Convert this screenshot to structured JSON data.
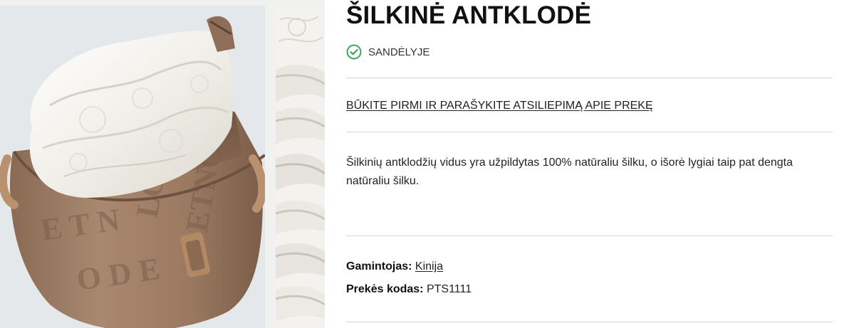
{
  "product": {
    "title": "ŠILKINĖ ANTKLODĖ",
    "stock_status": "SANDĖLYJE",
    "review_link": "BŪKITE PIRMI IR PARAŠYKITE ATSILIEPIMĄ APIE PREKĘ",
    "description": "Šilkinių antklodžių vidus yra užpildytas 100% natūraliu šilku, o išorė lygiai taip pat dengta natūraliu šilku.",
    "manufacturer_label": "Gamintojas:",
    "manufacturer_value": "Kinija",
    "code_label": "Prekės kodas:",
    "code_value": "PTS1111"
  },
  "icons": {
    "stock": "check-circle-icon"
  },
  "colors": {
    "accent_green": "#3aa65a",
    "divider": "#d6d6d6",
    "bag_brown": "#a07f66"
  }
}
